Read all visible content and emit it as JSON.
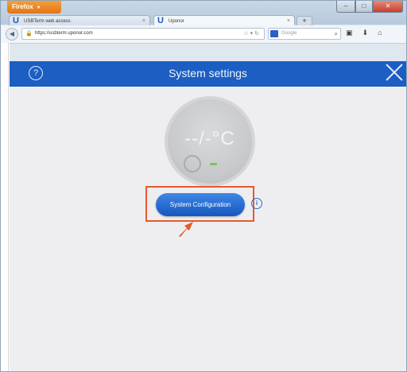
{
  "browser": {
    "menu_button_label": "Firefox",
    "tabs": [
      {
        "label": "USBTerm web access",
        "active": false
      },
      {
        "label": "Uponor",
        "active": true
      }
    ],
    "new_tab_label": "+",
    "url": "https://usbterm.uponor.com",
    "search_placeholder": "Google",
    "window_controls": {
      "minimize": "–",
      "maximize": "□",
      "close": "✕"
    }
  },
  "app": {
    "header_title": "System settings",
    "help_icon_label": "?",
    "temperature_display": "--/-°C",
    "config_button_label": "System Configuration",
    "info_icon_label": "i"
  },
  "colors": {
    "header_blue": "#1c5ec2",
    "button_blue": "#1f63cf",
    "highlight_orange": "#e8592b",
    "status_green": "#7ec35a"
  }
}
